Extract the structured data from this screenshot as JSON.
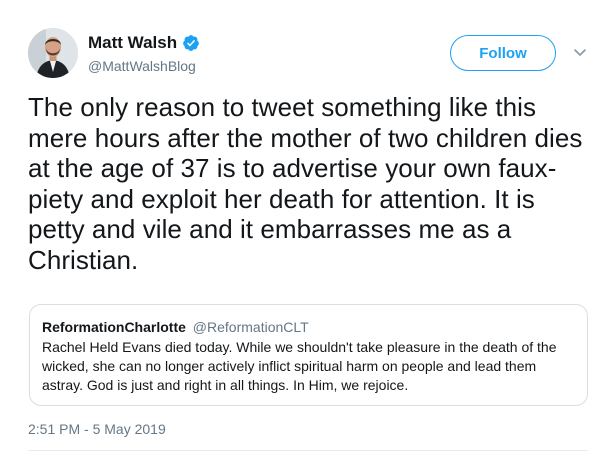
{
  "author": {
    "display_name": "Matt Walsh",
    "handle": "@MattWalshBlog",
    "verified": true
  },
  "follow_button": {
    "label": "Follow"
  },
  "tweet": {
    "text": "The only reason to tweet something like this mere hours after the mother of two children dies at the age of 37 is to advertise your own faux-piety and exploit her death for attention. It is petty and vile and it embarrasses me as a Christian.",
    "timestamp": "2:51 PM - 5 May 2019"
  },
  "quoted_tweet": {
    "display_name": "ReformationCharlotte",
    "handle": "@ReformationCLT",
    "text": "Rachel Held Evans died today. While we shouldn't take pleasure in the death of the wicked, she can no longer actively inflict spiritual harm on people and lead them astray. God is just and right in all things. In Him, we rejoice."
  },
  "icons": {
    "verified": "verified-badge-icon",
    "caret": "chevron-down-icon"
  },
  "colors": {
    "accent": "#1da1f2",
    "text": "#14171a",
    "secondary_text": "#657786",
    "border": "#d8dee3"
  }
}
